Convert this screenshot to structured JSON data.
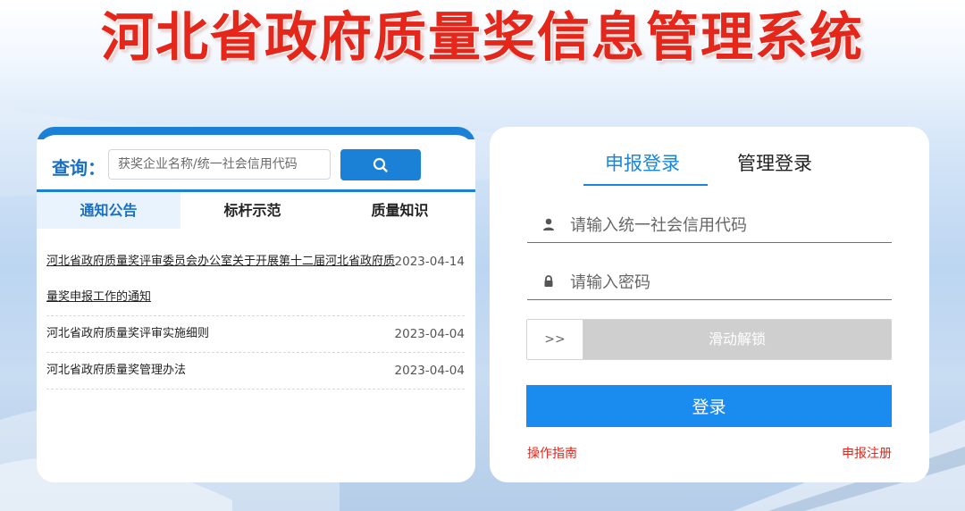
{
  "header": {
    "title": "河北省政府质量奖信息管理系统"
  },
  "search": {
    "label": "查询：",
    "placeholder": "获奖企业名称/统一社会信用代码",
    "button_icon": "search-icon"
  },
  "tabs": [
    {
      "label": "通知公告",
      "active": true
    },
    {
      "label": "标杆示范",
      "active": false
    },
    {
      "label": "质量知识",
      "active": false
    }
  ],
  "news": [
    {
      "title": "河北省政府质量奖评审委员会办公室关于开展第十二届河北省政府质量奖申报工作的通知",
      "date": "2023-04-14"
    },
    {
      "title": "河北省政府质量奖评审实施细则",
      "date": "2023-04-04"
    },
    {
      "title": "河北省政府质量奖管理办法",
      "date": "2023-04-04"
    }
  ],
  "login": {
    "tabs": [
      {
        "label": "申报登录",
        "active": true
      },
      {
        "label": "管理登录",
        "active": false
      }
    ],
    "username_placeholder": "请输入统一社会信用代码",
    "username_icon": "user-icon",
    "password_placeholder": "请输入密码",
    "password_icon": "lock-icon",
    "slider_handle": ">>",
    "slider_text": "滑动解锁",
    "submit_label": "登录",
    "guide_link": "操作指南",
    "register_link": "申报注册"
  },
  "colors": {
    "title_red": "#e4261b",
    "primary_blue": "#1a81d6",
    "login_blue": "#1a8cf0",
    "link_red": "#e3251b"
  }
}
